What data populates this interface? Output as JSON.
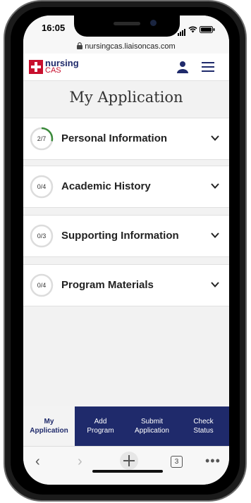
{
  "status_bar": {
    "time": "16:05"
  },
  "browser": {
    "url": "nursingcas.liaisoncas.com",
    "tab_count": "3"
  },
  "header": {
    "logo_top": "nursing",
    "logo_bottom": "CAS"
  },
  "page": {
    "title": "My Application"
  },
  "sections": [
    {
      "progress": "2/7",
      "label": "Personal Information",
      "fraction": 0.2857
    },
    {
      "progress": "0/4",
      "label": "Academic History",
      "fraction": 0
    },
    {
      "progress": "0/3",
      "label": "Supporting Information",
      "fraction": 0
    },
    {
      "progress": "0/4",
      "label": "Program Materials",
      "fraction": 0
    }
  ],
  "tabbar": [
    {
      "line1": "My",
      "line2": "Application"
    },
    {
      "line1": "Add",
      "line2": "Program"
    },
    {
      "line1": "Submit",
      "line2": "Application"
    },
    {
      "line1": "Check",
      "line2": "Status"
    }
  ],
  "icons": {
    "user": "user-icon",
    "menu": "hamburger-menu-icon",
    "lock": "lock-icon",
    "chevron": "chevron-down-icon",
    "back": "back-arrow-icon",
    "forward": "forward-arrow-icon",
    "new_tab": "plus-icon",
    "tabs": "tabs-icon",
    "more": "more-icon"
  },
  "colors": {
    "navy": "#1f2a6b",
    "red": "#c8102e",
    "progress_green": "#3a8a3a"
  }
}
